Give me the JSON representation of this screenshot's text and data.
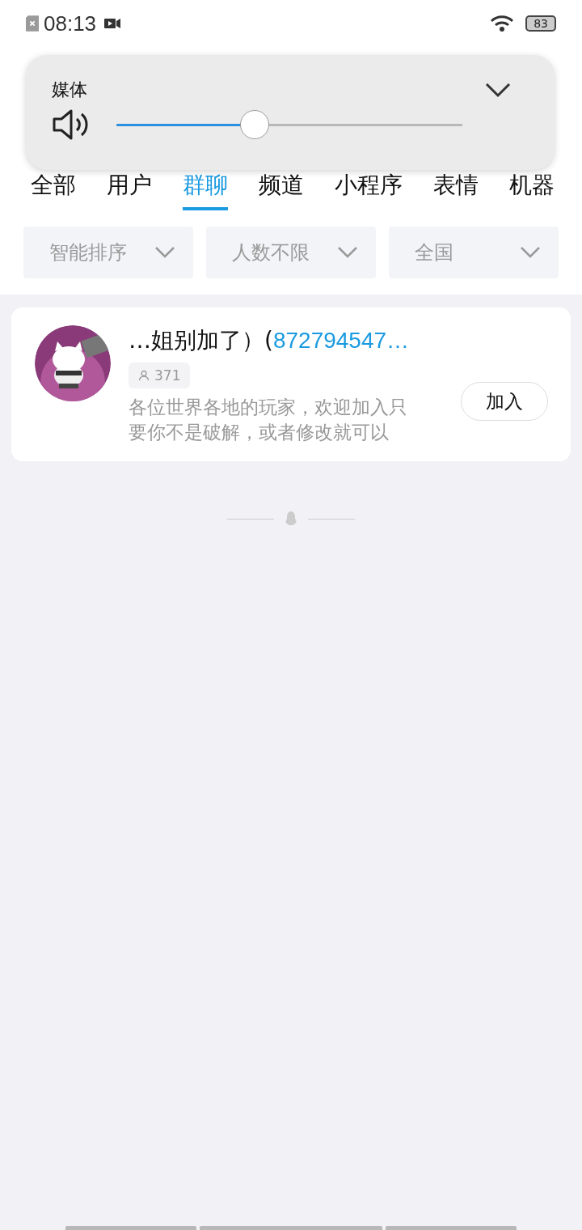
{
  "status_bar": {
    "time": "08:13",
    "battery": "83"
  },
  "volume_panel": {
    "title": "媒体",
    "level": 0.4
  },
  "tabs": [
    {
      "label": "全部",
      "selected": false
    },
    {
      "label": "用户",
      "selected": false
    },
    {
      "label": "群聊",
      "selected": true
    },
    {
      "label": "频道",
      "selected": false
    },
    {
      "label": "小程序",
      "selected": false
    },
    {
      "label": "表情",
      "selected": false
    },
    {
      "label": "机器",
      "selected": false
    }
  ],
  "filters": [
    "智能排序",
    "人数不限",
    "全国"
  ],
  "results": [
    {
      "title": "…姐别加了）(",
      "highlight": "872794547…",
      "members": "371",
      "description": "各位世界各地的玩家，欢迎加入只要你不是破解，或者修改就可以",
      "button": "加入"
    }
  ]
}
